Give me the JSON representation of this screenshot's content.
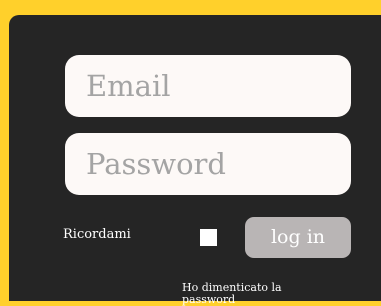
{
  "login_form": {
    "email_placeholder": "Email",
    "password_placeholder": "Password",
    "remember_label": "Ricordami",
    "remember_checked": false,
    "login_label": "log in",
    "forgot_password_label": "Ho dimenticato la password"
  },
  "colors": {
    "background": "#ffd02b",
    "panel": "#252525",
    "field": "#fdf9f7",
    "placeholder": "#a4a4a4",
    "button": "#b9b5b5"
  }
}
